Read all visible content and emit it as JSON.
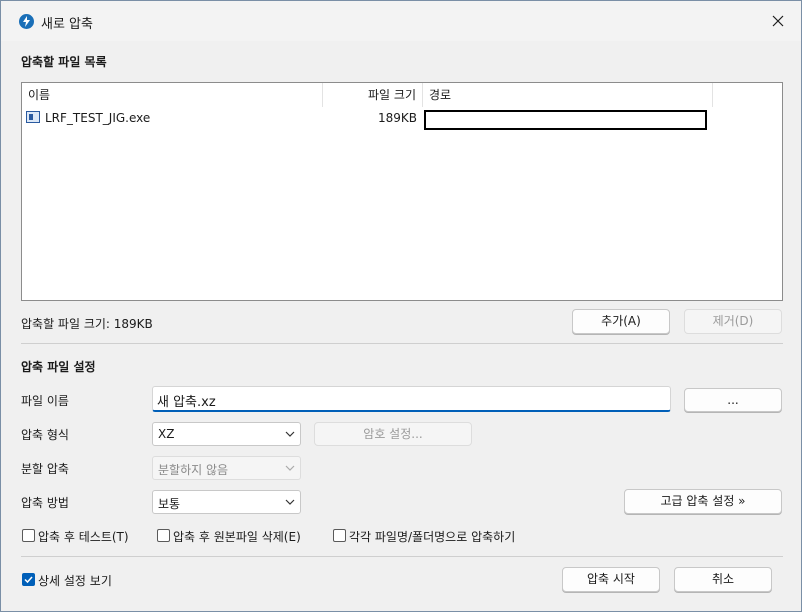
{
  "window": {
    "title": "새로 압축",
    "close_icon": "close-icon"
  },
  "file_list": {
    "section_title": "압축할 파일 목록",
    "columns": [
      "이름",
      "파일 크기",
      "경로"
    ],
    "rows": [
      {
        "name": "LRF_TEST_JIG.exe",
        "size": "189KB",
        "path": ""
      }
    ],
    "total_size_label": "압축할 파일 크기: 189KB",
    "add_button": "추가(A)",
    "remove_button": "제거(D)"
  },
  "settings": {
    "section_title": "압축 파일 설정",
    "filename_label": "파일 이름",
    "filename_value": "새 압축.xz",
    "browse_button": "...",
    "format_label": "압축 형식",
    "format_value": "XZ",
    "password_button": "암호 설정...",
    "split_label": "분할 압축",
    "split_value": "분할하지 않음",
    "method_label": "압축 방법",
    "method_value": "보통",
    "advanced_button": "고급 압축 설정 »",
    "options": [
      {
        "label": "압축 후 테스트(T)",
        "checked": false
      },
      {
        "label": "압축 후 원본파일 삭제(E)",
        "checked": false
      },
      {
        "label": "각각 파일명/폴더명으로 압축하기",
        "checked": false
      }
    ]
  },
  "footer": {
    "details_label": "상세 설정 보기",
    "details_checked": true,
    "start_button": "압축 시작",
    "cancel_button": "취소"
  }
}
